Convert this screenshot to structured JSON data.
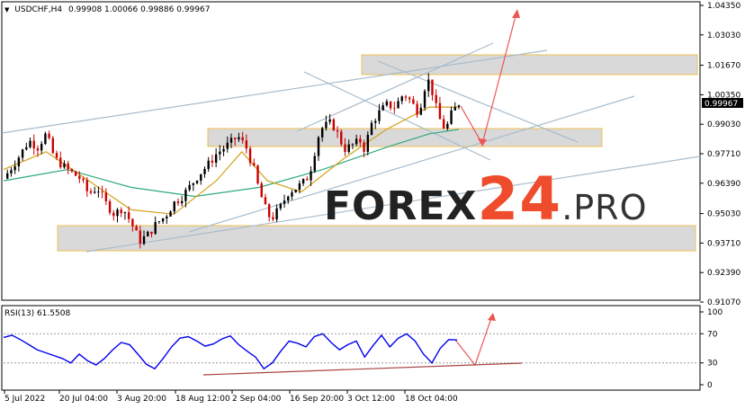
{
  "header": {
    "symbol_title": "USDCHF,H4",
    "ohlc": "0.99908 1.00066 0.99886 0.99967",
    "dropdown_glyph": "▼"
  },
  "watermark": {
    "part1": "FOREX",
    "part2": "24",
    "part3": ".PRO"
  },
  "chart_data": [
    {
      "type": "line",
      "title": "USDCHF,H4",
      "ohlc_readout": [
        "0.99908",
        "1.00066",
        "0.99886",
        "0.99967"
      ],
      "last_price": "0.99967",
      "y_ticks": [
        "1.04350",
        "1.03030",
        "1.01670",
        "1.00350",
        "0.99030",
        "0.97710",
        "0.96390",
        "0.95030",
        "0.93710",
        "0.92390",
        "0.91070"
      ],
      "ylim": [
        0.9107,
        1.0435
      ],
      "x_ticks": [
        "5 Jul 2022",
        "20 Jul 04:00",
        "3 Aug 20:00",
        "18 Aug 12:00",
        "2 Sep 04:00",
        "16 Sep 20:00",
        "3 Oct 12:00",
        "18 Oct 04:00"
      ],
      "price_path": [
        [
          0,
          0.966
        ],
        [
          3,
          0.974
        ],
        [
          6,
          0.983
        ],
        [
          8,
          0.98
        ],
        [
          10,
          0.986
        ],
        [
          12,
          0.975
        ],
        [
          15,
          0.97
        ],
        [
          18,
          0.966
        ],
        [
          20,
          0.959
        ],
        [
          22,
          0.962
        ],
        [
          24,
          0.955
        ],
        [
          26,
          0.95
        ],
        [
          28,
          0.953
        ],
        [
          30,
          0.946
        ],
        [
          32,
          0.938
        ],
        [
          34,
          0.941
        ],
        [
          36,
          0.946
        ],
        [
          38,
          0.949
        ],
        [
          40,
          0.955
        ],
        [
          42,
          0.958
        ],
        [
          44,
          0.963
        ],
        [
          46,
          0.968
        ],
        [
          48,
          0.972
        ],
        [
          50,
          0.977
        ],
        [
          52,
          0.98
        ],
        [
          54,
          0.983
        ],
        [
          55,
          0.985
        ],
        [
          57,
          0.98
        ],
        [
          59,
          0.969
        ],
        [
          60,
          0.961
        ],
        [
          62,
          0.95
        ],
        [
          63,
          0.948
        ],
        [
          65,
          0.953
        ],
        [
          67,
          0.96
        ],
        [
          69,
          0.962
        ],
        [
          71,
          0.965
        ],
        [
          72,
          0.969
        ],
        [
          73,
          0.977
        ],
        [
          74,
          0.985
        ],
        [
          75,
          0.989
        ],
        [
          77,
          0.991
        ],
        [
          78,
          0.988
        ],
        [
          79,
          0.984
        ],
        [
          80,
          0.979
        ],
        [
          82,
          0.981
        ],
        [
          84,
          0.983
        ],
        [
          85,
          0.978
        ],
        [
          86,
          0.989
        ],
        [
          88,
          0.995
        ],
        [
          90,
          0.999
        ],
        [
          92,
          0.998
        ],
        [
          94,
          1.004
        ],
        [
          96,
          1.0
        ],
        [
          97,
          0.996
        ],
        [
          98,
          0.999
        ],
        [
          99,
          1.007
        ],
        [
          100,
          1.01
        ],
        [
          101,
          1.003
        ],
        [
          102,
          0.995
        ],
        [
          103,
          0.99
        ],
        [
          104,
          0.988
        ],
        [
          105,
          0.994
        ],
        [
          106,
          0.997
        ],
        [
          107,
          0.9997
        ]
      ],
      "ma_fast": [
        [
          0,
          0.97
        ],
        [
          10,
          0.978
        ],
        [
          20,
          0.965
        ],
        [
          30,
          0.952
        ],
        [
          40,
          0.95
        ],
        [
          50,
          0.965
        ],
        [
          56,
          0.978
        ],
        [
          62,
          0.965
        ],
        [
          70,
          0.96
        ],
        [
          80,
          0.975
        ],
        [
          90,
          0.988
        ],
        [
          100,
          0.998
        ],
        [
          107,
          0.998
        ]
      ],
      "ma_slow": [
        [
          0,
          0.965
        ],
        [
          15,
          0.97
        ],
        [
          30,
          0.962
        ],
        [
          45,
          0.958
        ],
        [
          60,
          0.962
        ],
        [
          75,
          0.97
        ],
        [
          90,
          0.98
        ],
        [
          100,
          0.986
        ],
        [
          107,
          0.988
        ]
      ]
    },
    {
      "type": "line",
      "title": "RSI(13) 61.5508",
      "y_ticks": [
        "100",
        "70",
        "30",
        "0"
      ],
      "ylim": [
        0,
        100
      ],
      "levels": [
        70,
        30
      ],
      "values": [
        65,
        68,
        62,
        55,
        48,
        44,
        40,
        36,
        30,
        42,
        33,
        27,
        36,
        48,
        58,
        55,
        42,
        28,
        22,
        36,
        52,
        64,
        66,
        60,
        53,
        56,
        63,
        67,
        55,
        46,
        38,
        22,
        30,
        46,
        60,
        57,
        52,
        66,
        70,
        58,
        48,
        55,
        60,
        38,
        54,
        68,
        52,
        64,
        70,
        60,
        42,
        30,
        50,
        62,
        61.5
      ]
    }
  ],
  "colors": {
    "bull_candle": "#000000",
    "bear_candle": "#cc0000",
    "ma_fast": "#d4a017",
    "ma_slow": "#2eaa7a",
    "rsi_line": "#0000ee",
    "zone_fill": "#d9d9d9",
    "zone_border": "#f0c050",
    "trendline": "#a8bccc",
    "arrow": "#ee5555",
    "rsi_trend": "#aa4444",
    "watermark_dark": "#222222",
    "watermark_accent": "#ee4c2c"
  }
}
